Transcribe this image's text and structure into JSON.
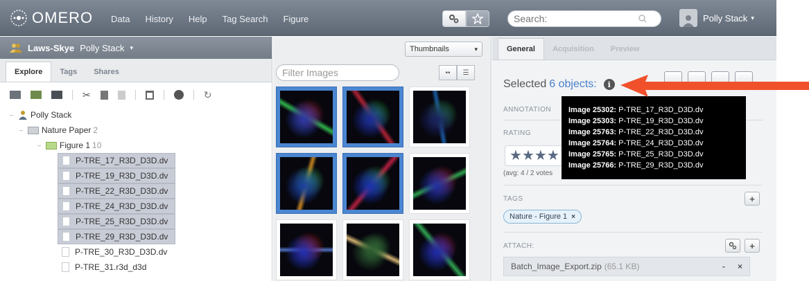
{
  "topbar": {
    "logo_text": "OMERO",
    "nav": [
      "Data",
      "History",
      "Help",
      "Tag Search",
      "Figure"
    ],
    "search_placeholder": "Search:",
    "user_name": "Polly Stack"
  },
  "left": {
    "group": "Laws-Skye",
    "group_user": "Polly Stack",
    "tabs": [
      "Explore",
      "Tags",
      "Shares"
    ],
    "tree": {
      "root": "Polly Stack",
      "project": "Nature Paper",
      "project_count": "2",
      "dataset": "Figure 1",
      "dataset_count": "10",
      "images": [
        {
          "name": "P-TRE_17_R3D_D3D.dv",
          "selected": true
        },
        {
          "name": "P-TRE_19_R3D_D3D.dv",
          "selected": true
        },
        {
          "name": "P-TRE_22_R3D_D3D.dv",
          "selected": true
        },
        {
          "name": "P-TRE_24_R3D_D3D.dv",
          "selected": true
        },
        {
          "name": "P-TRE_25_R3D_D3D.dv",
          "selected": true
        },
        {
          "name": "P-TRE_29_R3D_D3D.dv",
          "selected": true
        },
        {
          "name": "P-TRE_30_R3D_D3D.dv",
          "selected": false
        },
        {
          "name": "P-TRE_31.r3d_d3d",
          "selected": false
        }
      ]
    }
  },
  "center": {
    "view_select": "Thumbnails",
    "filter_placeholder": "Filter Images",
    "thumbnails_selected": [
      true,
      true,
      false,
      true,
      true,
      false,
      false,
      false,
      false
    ]
  },
  "right": {
    "tabs": [
      "General",
      "Acquisition",
      "Preview"
    ],
    "selected_prefix": "Selected",
    "selected_link": "6 objects:",
    "sections": {
      "annotations": "ANNOTATION",
      "rating": "RATING",
      "tags": "TAGS",
      "attach": "ATTACH:"
    },
    "rating_value": 4,
    "avg_text": "(avg: 4 / 2 votes",
    "tag": "Nature - Figure 1",
    "attachment": {
      "name": "Batch_Image_Export.zip",
      "size": "(65.1 KB)"
    }
  },
  "tooltip": {
    "lines": [
      {
        "id": "Image 25302:",
        "name": "P-TRE_17_R3D_D3D.dv"
      },
      {
        "id": "Image 25303:",
        "name": "P-TRE_19_R3D_D3D.dv"
      },
      {
        "id": "Image 25763:",
        "name": "P-TRE_22_R3D_D3D.dv"
      },
      {
        "id": "Image 25764:",
        "name": "P-TRE_24_R3D_D3D.dv"
      },
      {
        "id": "Image 25765:",
        "name": "P-TRE_25_R3D_D3D.dv"
      },
      {
        "id": "Image 25766:",
        "name": "P-TRE_29_R3D_D3D.dv"
      }
    ]
  },
  "colors": {
    "accent_arrow": "#f0512b",
    "link": "#4a80c9",
    "selection_thumb": "#4b86d1"
  }
}
